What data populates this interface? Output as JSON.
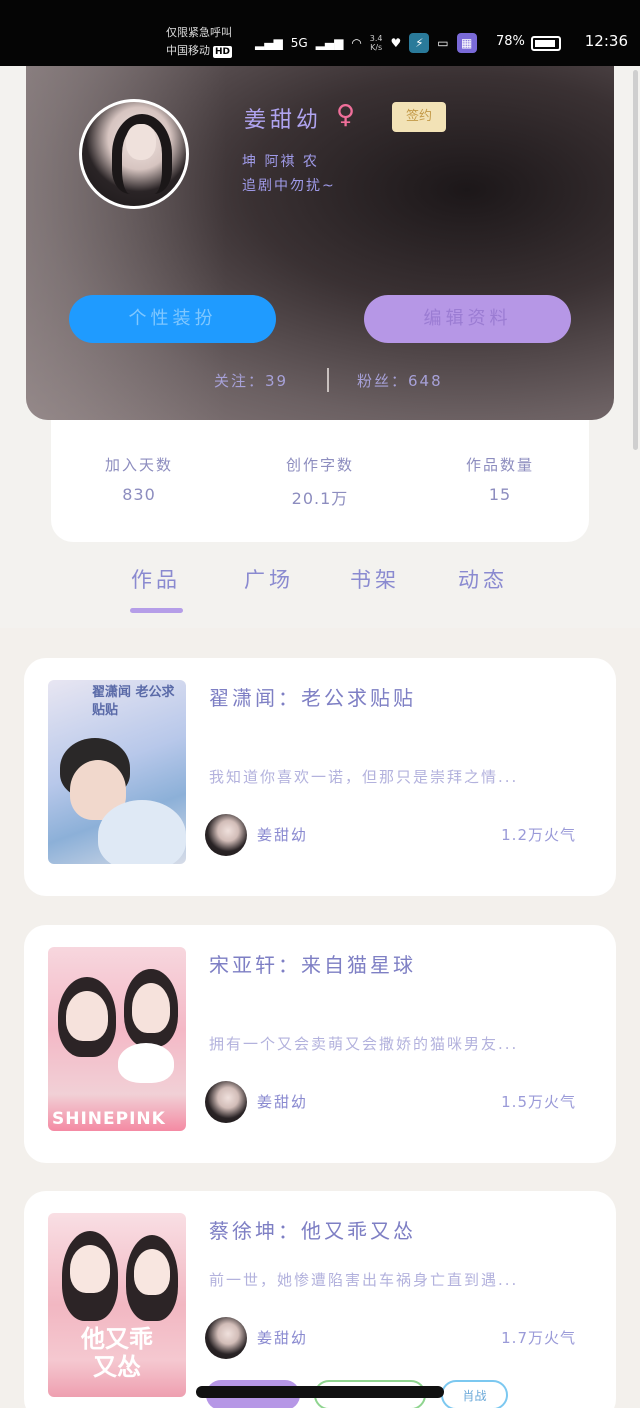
{
  "status_bar": {
    "carrier_line1": "仅限紧急呼叫",
    "carrier_line2": "中国移动",
    "hd": "HD",
    "network": "5G",
    "speed_value": "3.4",
    "speed_unit": "K/s",
    "battery_pct": "78%",
    "time": "12:36"
  },
  "profile": {
    "username": "姜甜幼",
    "gender_symbol": "♀",
    "contract_badge": "签约",
    "bio_line1": "坤 阿祺 农",
    "bio_line2": "追剧中勿扰~",
    "style_button": "个性装扮",
    "edit_button": "编辑资料",
    "following_label": "关注：39",
    "fans_label": "粉丝：648"
  },
  "stats": [
    {
      "label": "加入天数",
      "value": "830"
    },
    {
      "label": "创作字数",
      "value": "20.1万"
    },
    {
      "label": "作品数量",
      "value": "15"
    }
  ],
  "tabs": [
    {
      "label": "作品"
    },
    {
      "label": "广场"
    },
    {
      "label": "书架"
    },
    {
      "label": "动态"
    }
  ],
  "works": [
    {
      "title": "翟潇闻：老公求贴贴",
      "desc": "我知道你喜欢一诺，但那只是崇拜之情...",
      "author": "姜甜幼",
      "heat": "1.2万火气",
      "cover_text": "翟潇闻 老公求贴贴"
    },
    {
      "title": "宋亚轩：来自猫星球",
      "desc": "拥有一个又会卖萌又会撒娇的猫咪男友...",
      "author": "姜甜幼",
      "heat": "1.5万火气",
      "cover_text": "SHINEPINK"
    },
    {
      "title": "蔡徐坤：他又乖又怂",
      "desc": "前一世，她惨遭陷害出车祸身亡直到遇...",
      "author": "姜甜幼",
      "heat": "1.7万火气",
      "cover_text": "他又乖 又怂"
    }
  ],
  "bottom_tags": {
    "tag3": "肖战"
  },
  "colors": {
    "accent_purple": "#b697e6",
    "accent_blue": "#1f9bff",
    "text_lavender": "#8a8ad0"
  }
}
